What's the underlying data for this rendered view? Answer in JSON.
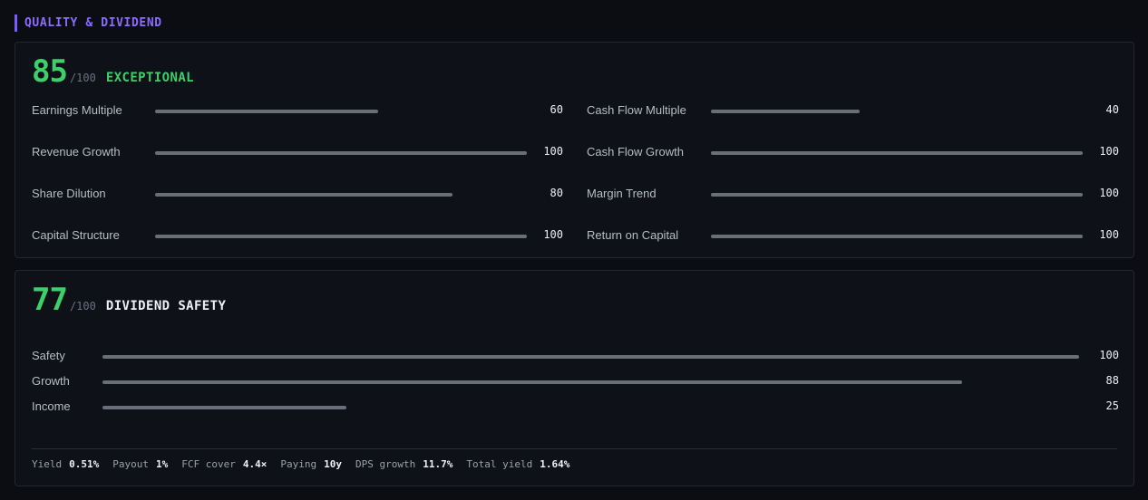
{
  "section": {
    "title": "QUALITY & DIVIDEND"
  },
  "quality": {
    "score": "85",
    "max": "/100",
    "rating": "EXCEPTIONAL",
    "left_metrics": [
      {
        "label": "Earnings Multiple",
        "value": "60",
        "fill": 60
      },
      {
        "label": "Revenue Growth",
        "value": "100",
        "fill": 100
      },
      {
        "label": "Share Dilution",
        "value": "80",
        "fill": 80
      },
      {
        "label": "Capital Structure",
        "value": "100",
        "fill": 100
      }
    ],
    "right_metrics": [
      {
        "label": "Cash Flow Multiple",
        "value": "40",
        "fill": 40
      },
      {
        "label": "Cash Flow Growth",
        "value": "100",
        "fill": 100
      },
      {
        "label": "Margin Trend",
        "value": "100",
        "fill": 100
      },
      {
        "label": "Return on Capital",
        "value": "100",
        "fill": 100
      }
    ]
  },
  "dividend": {
    "score": "77",
    "max": "/100",
    "title": "DIVIDEND SAFETY",
    "metrics": [
      {
        "label": "Safety",
        "value": "100",
        "fill": 100
      },
      {
        "label": "Growth",
        "value": "88",
        "fill": 88
      },
      {
        "label": "Income",
        "value": "25",
        "fill": 25
      }
    ],
    "stats": [
      {
        "key": "Yield",
        "value": "0.51%"
      },
      {
        "key": "Payout",
        "value": "1%"
      },
      {
        "key": "FCF cover",
        "value": "4.4×"
      },
      {
        "key": "Paying",
        "value": "10y"
      },
      {
        "key": "DPS growth",
        "value": "11.7%"
      },
      {
        "key": "Total yield",
        "value": "1.64%"
      }
    ]
  },
  "colors": {
    "accent": "#7b5cff",
    "score_green": "#3ecf6a",
    "bar_fill": "#6a6e78"
  }
}
